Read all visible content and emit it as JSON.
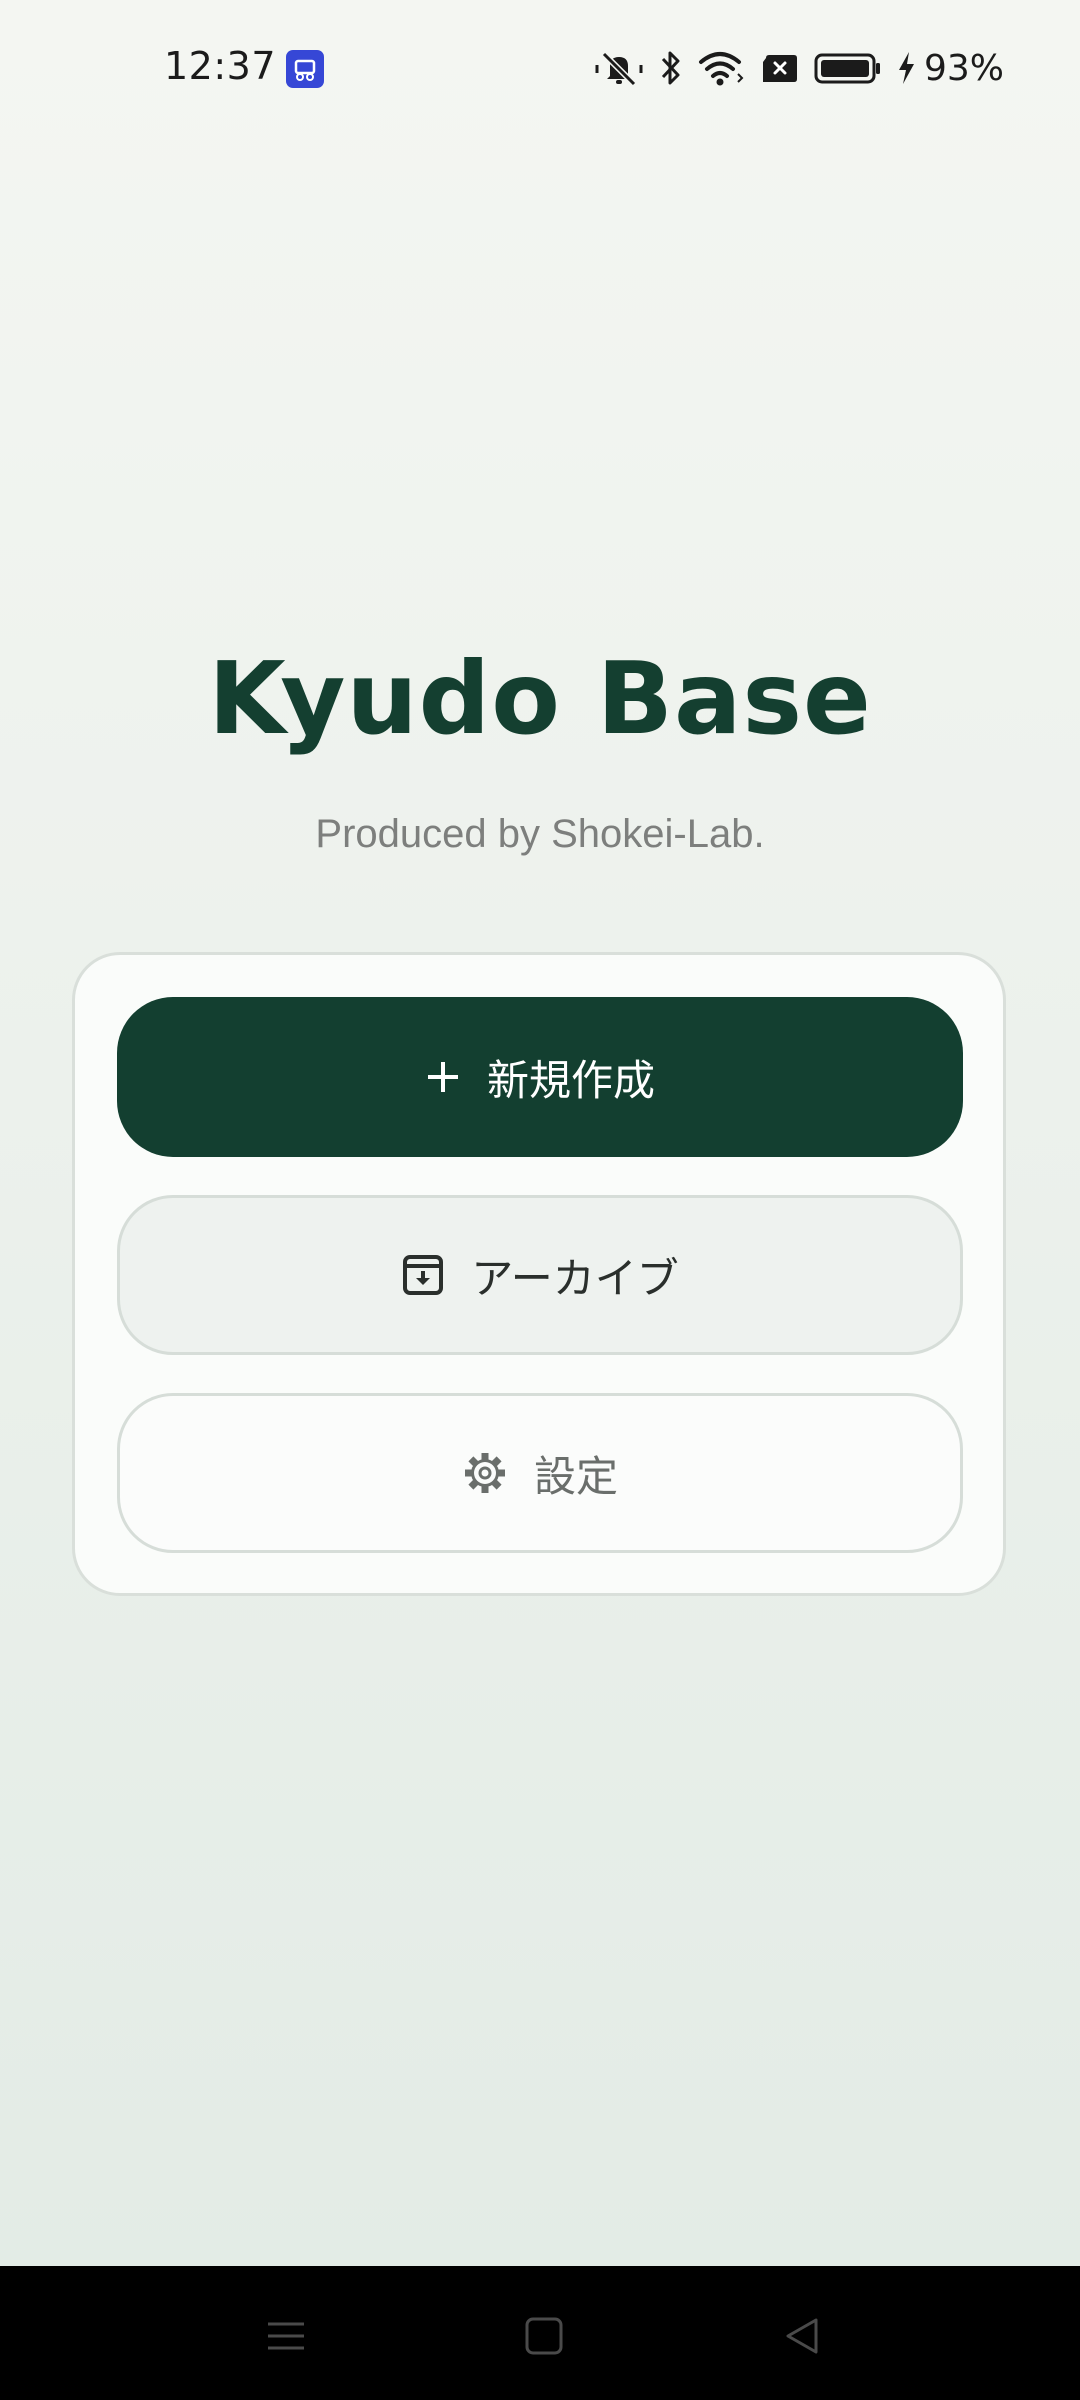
{
  "status_bar": {
    "time": "12:37",
    "battery_percent": "93%",
    "icons": [
      "app-notification-icon",
      "mute-icon",
      "bluetooth-icon",
      "wifi-icon",
      "no-sim-icon",
      "battery-icon",
      "charging-icon"
    ]
  },
  "header": {
    "title": "Kyudo Base",
    "subtitle": "Produced by Shokei-Lab."
  },
  "menu": {
    "new_label": "新規作成",
    "archive_label": "アーカイブ",
    "settings_label": "設定"
  },
  "colors": {
    "primary": "#133f30",
    "title": "#143f30",
    "subtitle": "#7d7f7d"
  },
  "nav_bar": {
    "buttons": [
      "menu-icon",
      "home-icon",
      "back-icon"
    ]
  }
}
